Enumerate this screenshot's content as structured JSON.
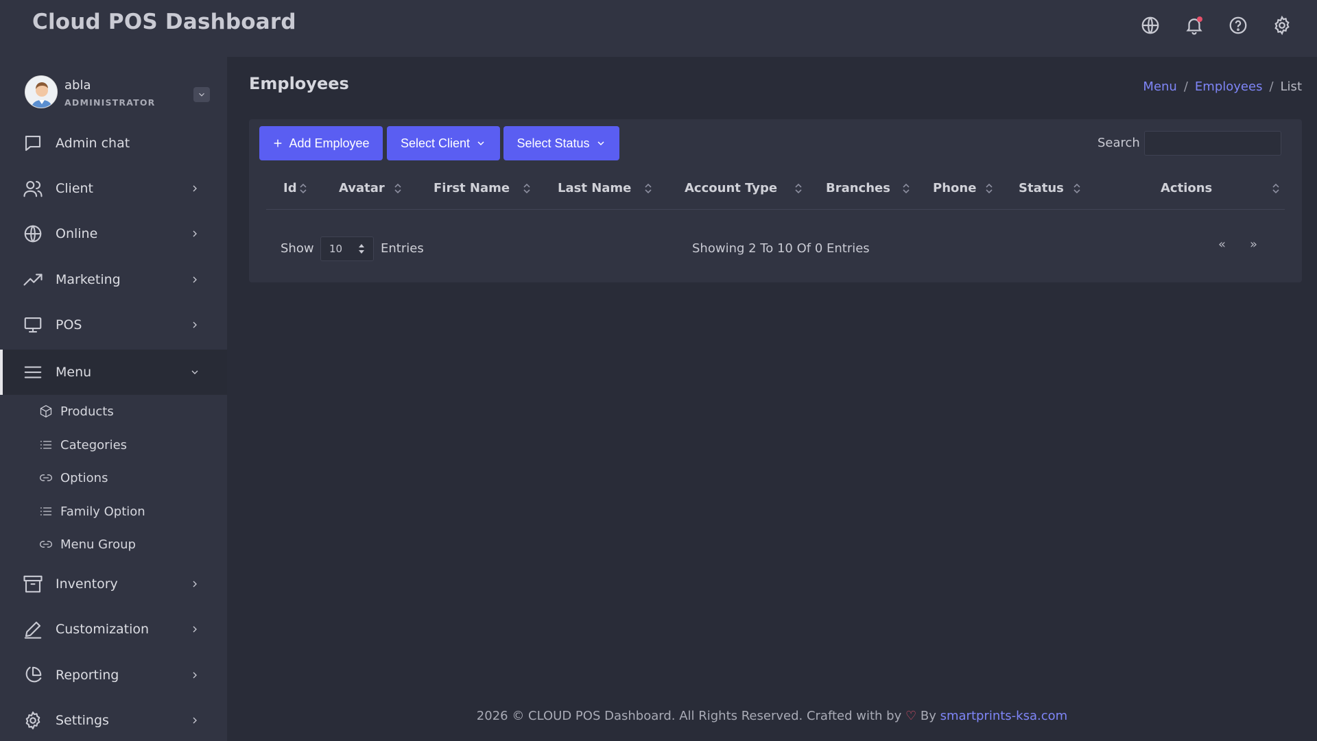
{
  "app": {
    "title": "Cloud POS Dashboard"
  },
  "topbar": {
    "icons": [
      "globe-icon",
      "bell-icon",
      "help-icon",
      "gear-icon"
    ],
    "notification_color": "#e6506a"
  },
  "user": {
    "name": "abla",
    "role": "ADMINISTRATOR"
  },
  "sidebar": {
    "items": [
      {
        "label": "Admin chat",
        "icon": "chat-icon",
        "has_chevron": false
      },
      {
        "label": "Client",
        "icon": "users-icon",
        "has_chevron": true
      },
      {
        "label": "Online",
        "icon": "globe-icon",
        "has_chevron": true
      },
      {
        "label": "Marketing",
        "icon": "trending-icon",
        "has_chevron": true
      },
      {
        "label": "POS",
        "icon": "monitor-icon",
        "has_chevron": true
      },
      {
        "label": "Menu",
        "icon": "menu-icon",
        "has_chevron": true,
        "expanded": true
      },
      {
        "label": "Inventory",
        "icon": "archive-icon",
        "has_chevron": true
      },
      {
        "label": "Customization",
        "icon": "pen-icon",
        "has_chevron": true
      },
      {
        "label": "Reporting",
        "icon": "pie-chart-icon",
        "has_chevron": true
      },
      {
        "label": "Settings",
        "icon": "gear-icon",
        "has_chevron": true
      }
    ],
    "menu_subitems": [
      {
        "label": "Products",
        "icon": "box-icon"
      },
      {
        "label": "Categories",
        "icon": "list-icon"
      },
      {
        "label": "Options",
        "icon": "link-icon"
      },
      {
        "label": "Family Option",
        "icon": "list-icon"
      },
      {
        "label": "Menu Group",
        "icon": "link-icon"
      }
    ]
  },
  "main": {
    "title": "Employees",
    "breadcrumb": {
      "first": "Menu",
      "second": "Employees",
      "current": "List",
      "separator": "/"
    },
    "toolbar": {
      "add_label": "Add Employee",
      "client_label": "Select Client",
      "status_label": "Select Status",
      "search_label": "Search",
      "search_value": "",
      "accent": "#5a5ef2"
    },
    "table": {
      "columns": [
        "Id",
        "Avatar",
        "First Name",
        "Last Name",
        "Account Type",
        "Branches",
        "Phone",
        "Status",
        "Actions"
      ],
      "rows": []
    },
    "pagination": {
      "show_label": "Show",
      "page_size": "10",
      "entries_label": "Entries",
      "summary": "Showing 2 To 10 Of 0 Entries",
      "prev": "«",
      "next": "»"
    }
  },
  "footer": {
    "text": "2026 © CLOUD POS Dashboard. All Rights Reserved. Crafted with by",
    "heart": "♡",
    "by": "By",
    "link": "smartprints-ksa.com"
  }
}
